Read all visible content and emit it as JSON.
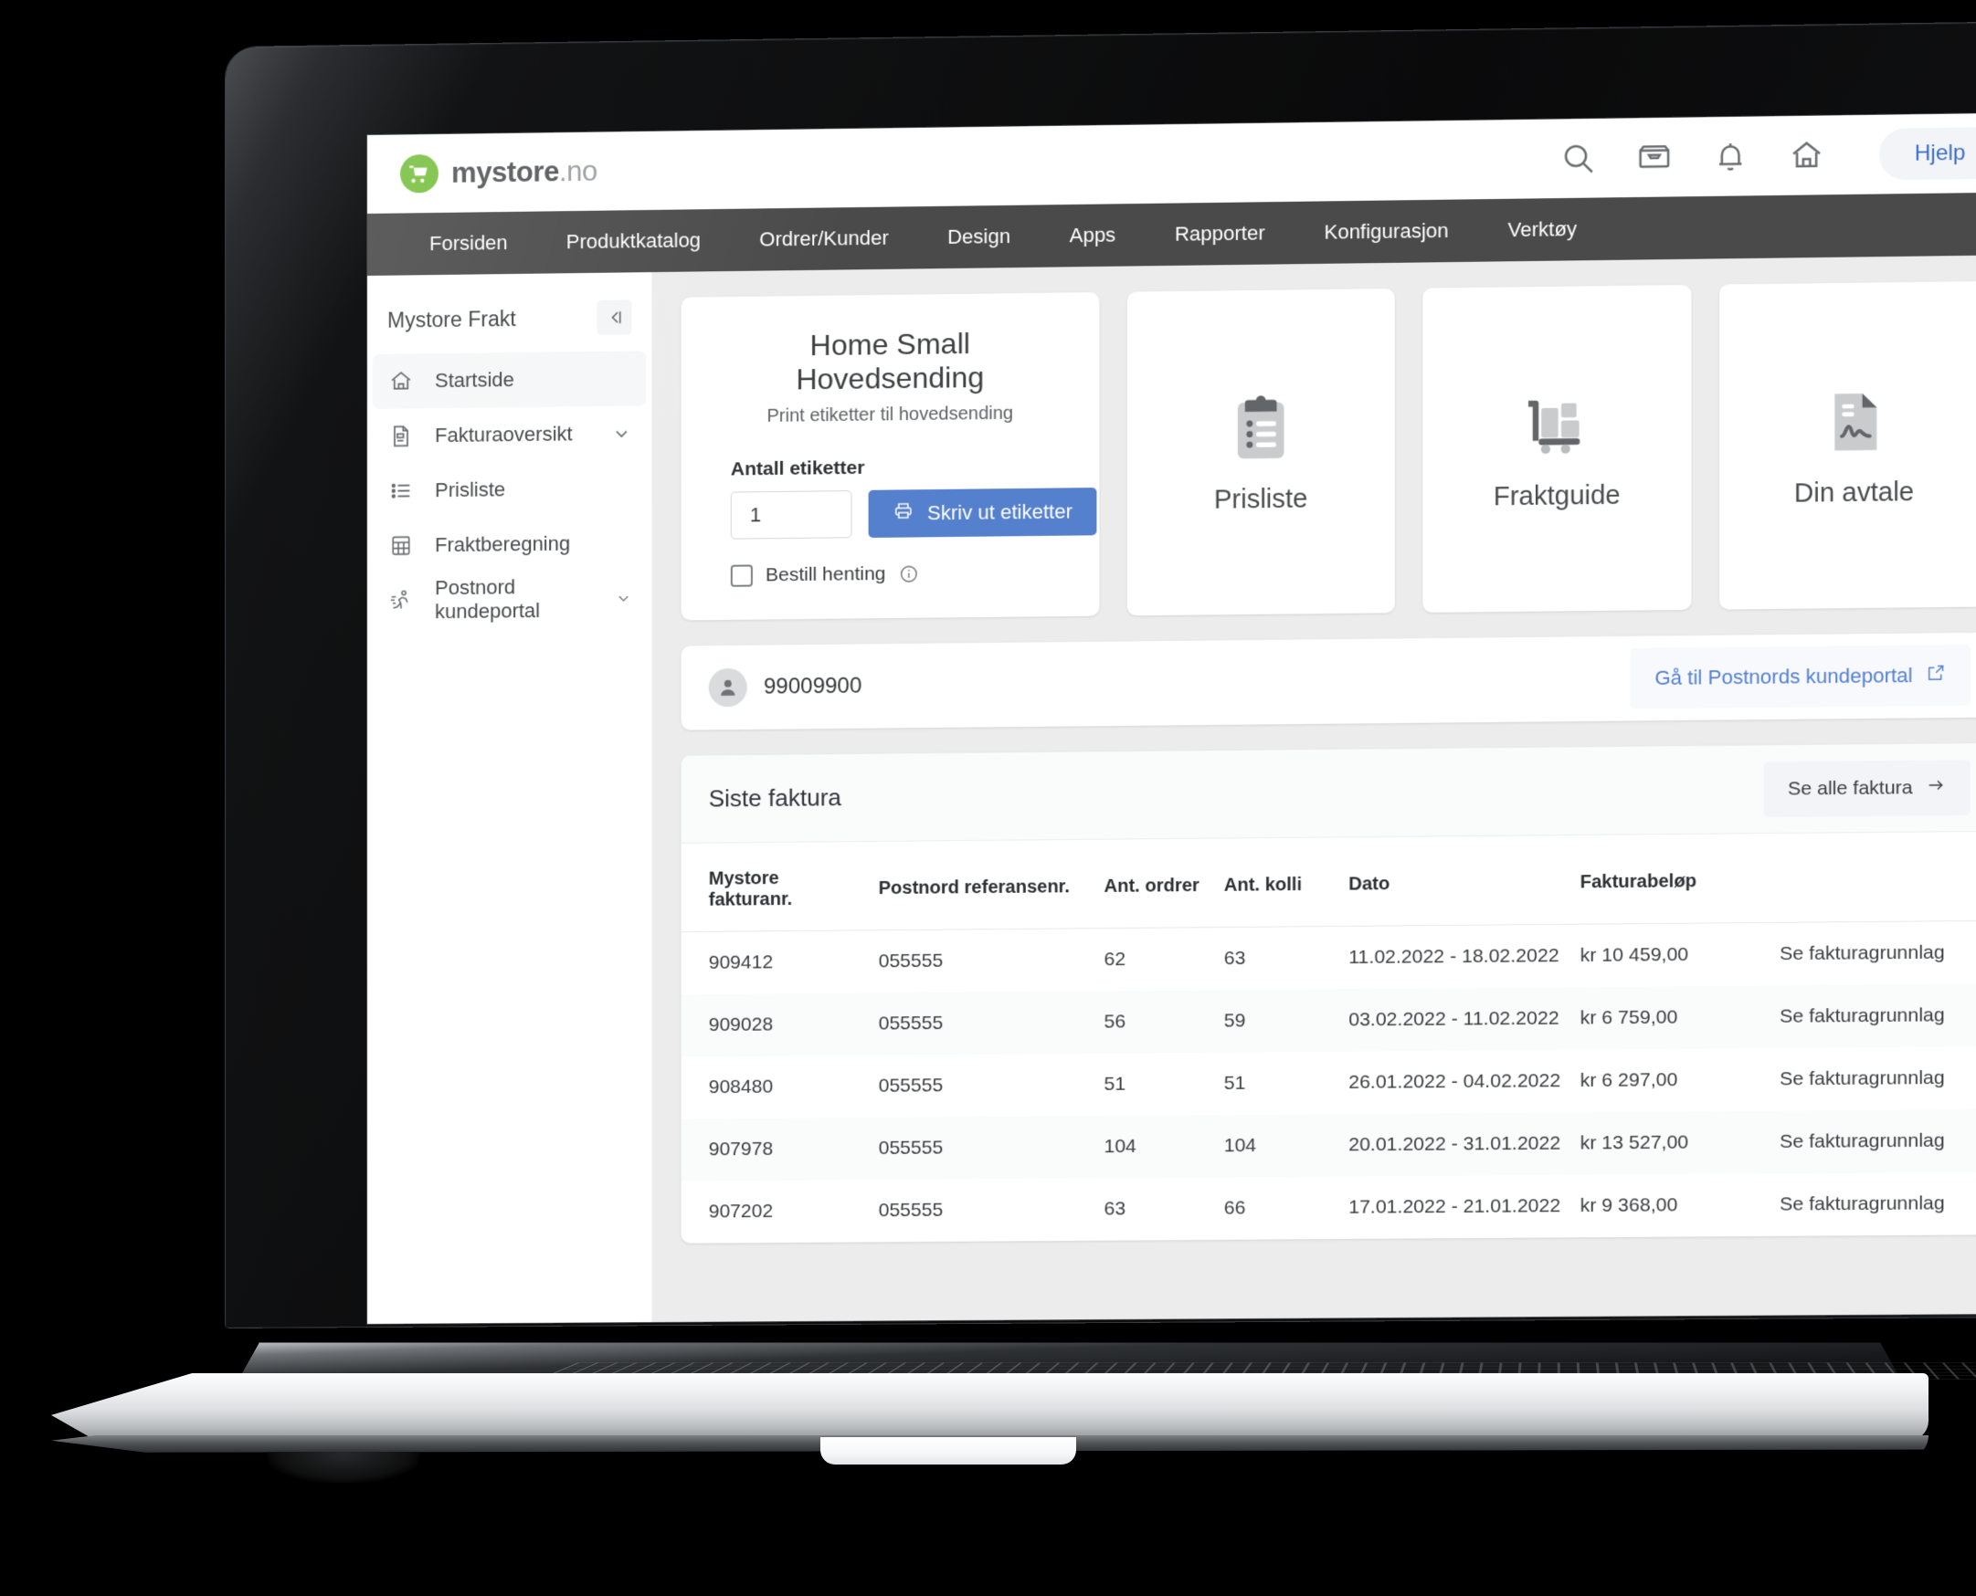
{
  "brand": {
    "name_bold": "mystore",
    "name_light": ".no",
    "mark_icon": "shopping-cart-icon",
    "mark_color": "#7ac143"
  },
  "topbar": {
    "icons": [
      {
        "name": "search-icon",
        "label": "search"
      },
      {
        "name": "inbox-icon",
        "label": "inbox"
      },
      {
        "name": "bell-icon",
        "label": "notifications"
      },
      {
        "name": "home-icon",
        "label": "home"
      }
    ],
    "help_label": "Hjelp"
  },
  "mainnav": {
    "items": [
      {
        "label": "Forsiden"
      },
      {
        "label": "Produktkatalog"
      },
      {
        "label": "Ordrer/Kunder"
      },
      {
        "label": "Design"
      },
      {
        "label": "Apps"
      },
      {
        "label": "Rapporter"
      },
      {
        "label": "Konfigurasjon"
      },
      {
        "label": "Verktøy"
      }
    ]
  },
  "sidebar": {
    "title": "Mystore Frakt",
    "collapse_icon": "collapse-left-icon",
    "items": [
      {
        "label": "Startside",
        "icon": "home-icon",
        "active": true,
        "chevron": false
      },
      {
        "label": "Fakturaoversikt",
        "icon": "document-icon",
        "active": false,
        "chevron": true
      },
      {
        "label": "Prisliste",
        "icon": "list-icon",
        "active": false,
        "chevron": false
      },
      {
        "label": "Fraktberegning",
        "icon": "calculator-icon",
        "active": false,
        "chevron": false
      },
      {
        "label": "Postnord kundeportal",
        "icon": "postnord-runner-icon",
        "active": false,
        "chevron": true
      }
    ]
  },
  "label_card": {
    "title": "Home Small Hovedsending",
    "subtitle": "Print etiketter til hovedsending",
    "qty_label": "Antall etiketter",
    "qty_value": "1",
    "qty_placeholder": "1",
    "print_button": "Skriv ut etiketter",
    "print_icon": "printer-icon",
    "checkbox_label": "Bestill henting",
    "checkbox_checked": false,
    "info_icon": "info-circle-icon",
    "button_color": "#5580cd"
  },
  "tiles": [
    {
      "label": "Prisliste",
      "icon": "clipboard-list-icon"
    },
    {
      "label": "Fraktguide",
      "icon": "hand-truck-icon"
    },
    {
      "label": "Din avtale",
      "icon": "document-signature-icon"
    }
  ],
  "account": {
    "avatar_icon": "user-avatar-icon",
    "customer_id": "99009900",
    "portal_link": "Gå til Postnords kundeportal",
    "portal_icon": "external-link-icon"
  },
  "invoices": {
    "title": "Siste faktura",
    "see_all_label": "Se alle faktura",
    "see_all_icon": "arrow-right-icon",
    "columns": [
      "Mystore fakturanr.",
      "Postnord referansenr.",
      "Ant. ordrer",
      "Ant. kolli",
      "Dato",
      "Fakturabeløp",
      ""
    ],
    "row_link_label": "Se fakturagrunnlag",
    "rows": [
      {
        "invoice_no": "909412",
        "reference_no": "055555",
        "orders": "62",
        "parcels": "63",
        "date": "11.02.2022 - 18.02.2022",
        "amount": "kr 10 459,00"
      },
      {
        "invoice_no": "909028",
        "reference_no": "055555",
        "orders": "56",
        "parcels": "59",
        "date": "03.02.2022 - 11.02.2022",
        "amount": "kr 6 759,00"
      },
      {
        "invoice_no": "908480",
        "reference_no": "055555",
        "orders": "51",
        "parcels": "51",
        "date": "26.01.2022 - 04.02.2022",
        "amount": "kr 6 297,00"
      },
      {
        "invoice_no": "907978",
        "reference_no": "055555",
        "orders": "104",
        "parcels": "104",
        "date": "20.01.2022 - 31.01.2022",
        "amount": "kr 13 527,00"
      },
      {
        "invoice_no": "907202",
        "reference_no": "055555",
        "orders": "63",
        "parcels": "66",
        "date": "17.01.2022 - 21.01.2022",
        "amount": "kr 9 368,00"
      }
    ]
  }
}
